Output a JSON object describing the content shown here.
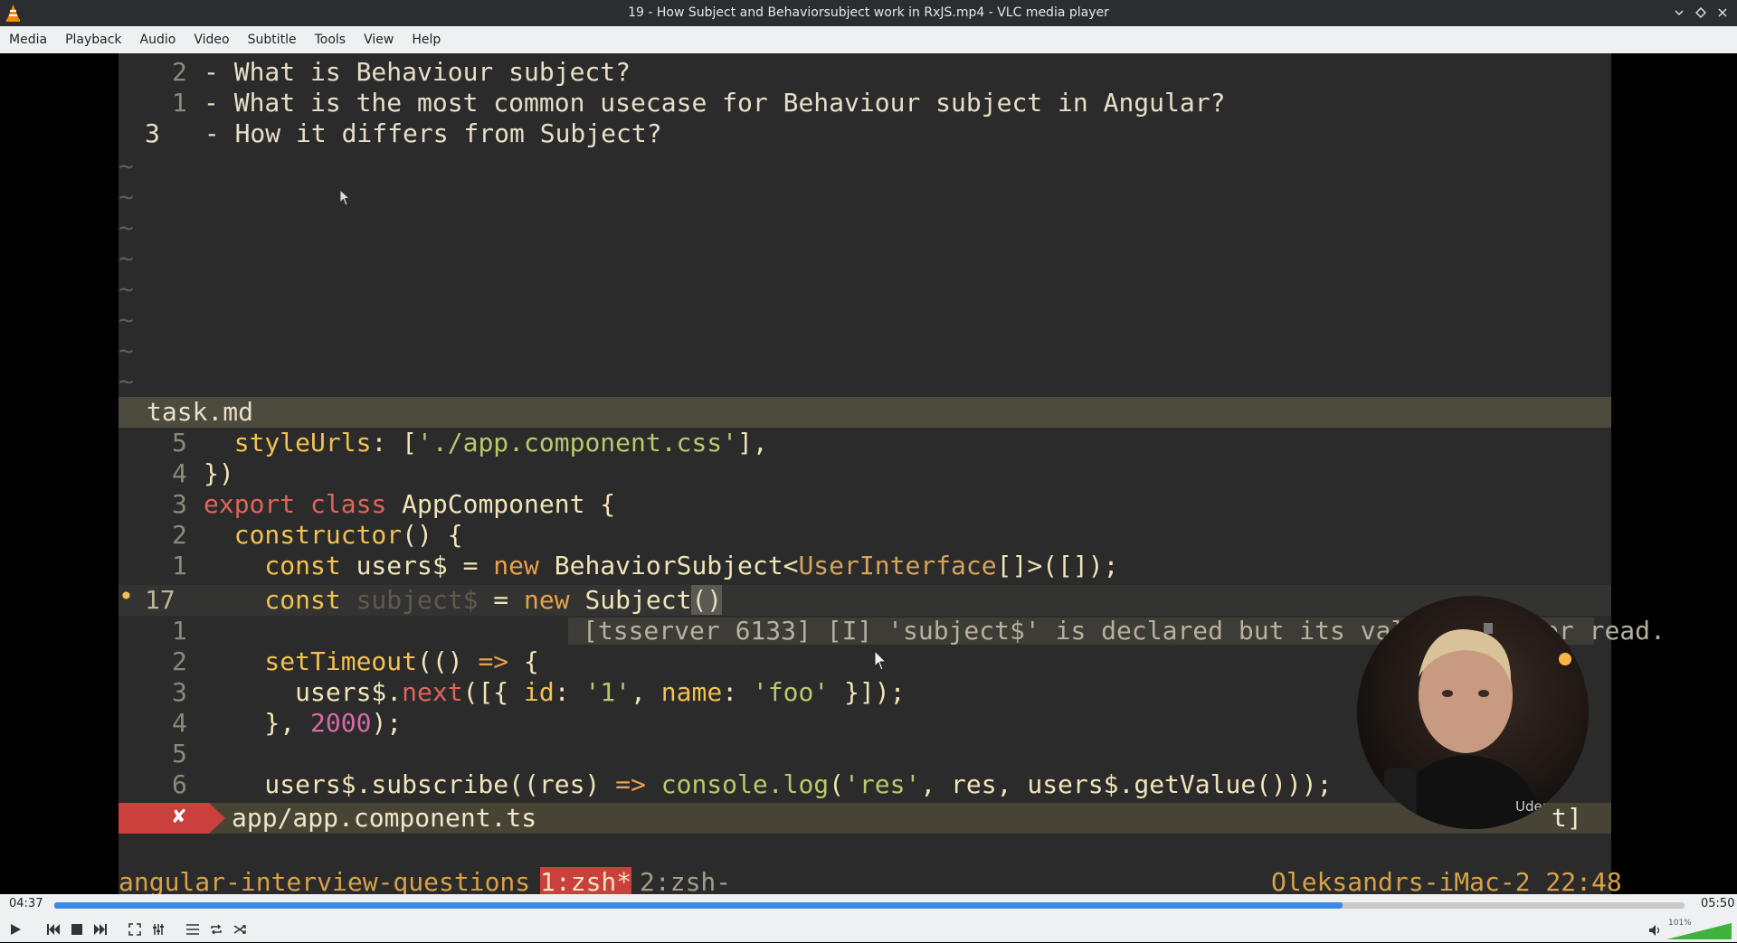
{
  "window": {
    "title": "19 - How Subject and Behaviorsubject work in RxJS.mp4 - VLC media player",
    "buttons": [
      "minimize",
      "maximize",
      "close"
    ]
  },
  "menu": [
    "Media",
    "Playback",
    "Audio",
    "Video",
    "Subtitle",
    "Tools",
    "View",
    "Help"
  ],
  "editor": {
    "top_pane_lines": [
      {
        "num": "2",
        "text": "- What is Behaviour subject?"
      },
      {
        "num": "1",
        "text": "- What is the most common usecase for Behaviour subject in Angular?"
      },
      {
        "num": "3",
        "text": " - How it differs from Subject?"
      }
    ],
    "top_status_filename": "task.md",
    "code_lines": [
      {
        "num": "5",
        "text": "  styleUrls: ['./app.component.css'],"
      },
      {
        "num": "4",
        "text": "})"
      },
      {
        "num": "3",
        "text": "export class AppComponent {"
      },
      {
        "num": "2",
        "text": "  constructor() {"
      },
      {
        "num": "1",
        "text": "    const users$ = new BehaviorSubject<UserInterface[]>([]);"
      },
      {
        "num": "17",
        "text": "    const subject$ = new Subject()"
      },
      {
        "num": "1",
        "text": ""
      },
      {
        "num": "2",
        "text": "    setTimeout(() => {"
      },
      {
        "num": "3",
        "text": "      users$.next([{ id: '1', name: 'foo' }]);"
      },
      {
        "num": "4",
        "text": "    }, 2000);"
      },
      {
        "num": "5",
        "text": ""
      },
      {
        "num": "6",
        "text": "    users$.subscribe((res) => console.log('res', res, users$.getValue()));"
      }
    ],
    "diagnostic": "[tsserver 6133] [I] 'subject$' is declared but its value is never read.",
    "bottom_status_filename": "app/app.component.ts",
    "bottom_status_right": "t]",
    "error_mark": "✘",
    "tmux": {
      "session": "angular-interview-questions §",
      "window1": "1:zsh*",
      "window2": "2:zsh-",
      "host": "Oleksandrs-iMac-2 22:48",
      "watermark": "Udemy"
    }
  },
  "player": {
    "elapsed": "04:37",
    "total": "05:50",
    "progress": 0.79,
    "volume_label": "101%",
    "volume": 1.01
  },
  "colors": {
    "accent": "#3b8be6",
    "terminal_bg": "#2b2b2b",
    "vlc_orange": "#f08c00"
  }
}
